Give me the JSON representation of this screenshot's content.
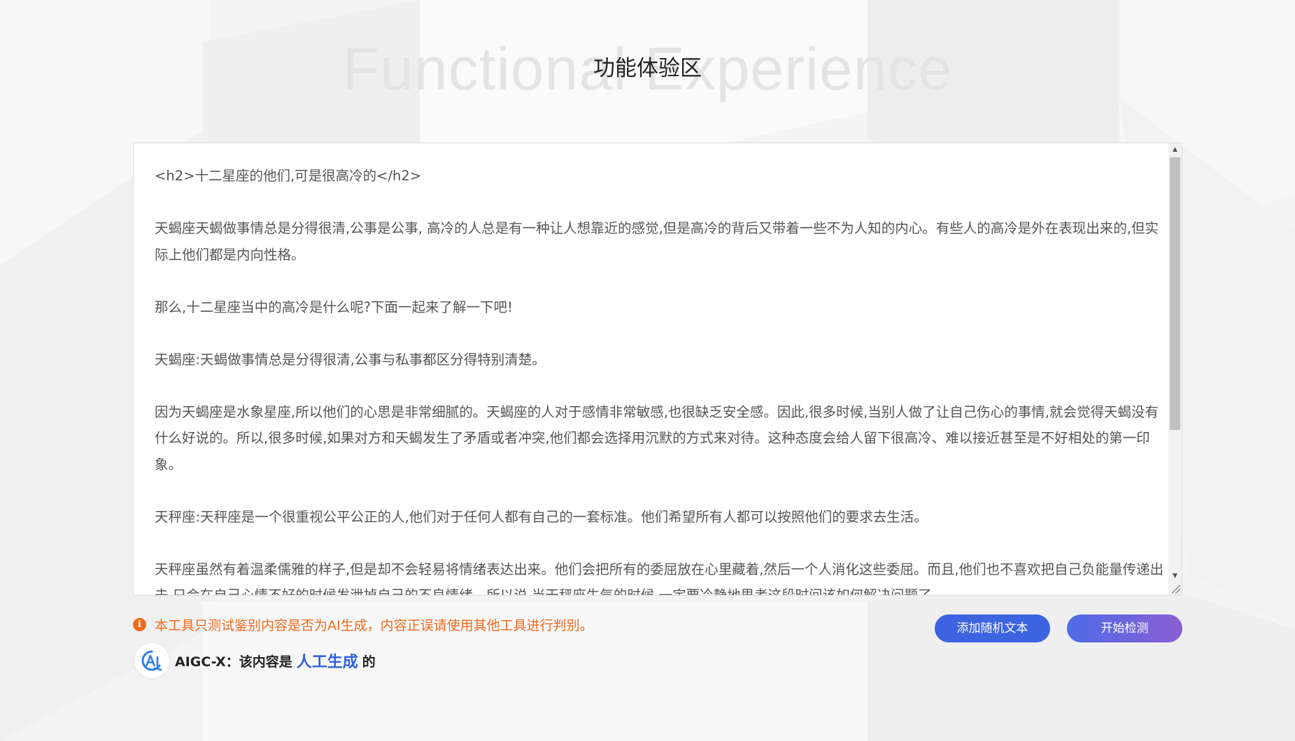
{
  "background": {
    "watermark": "Functional Experience"
  },
  "section": {
    "title": "功能体验区"
  },
  "editor": {
    "paragraphs": [
      "<h2>十二星座的他们,可是很高冷的</h2>",
      "天蝎座天蝎做事情总是分得很清,公事是公事, 高冷的人总是有一种让人想靠近的感觉,但是高冷的背后又带着一些不为人知的内心。有些人的高冷是外在表现出来的,但实际上他们都是内向性格。",
      "那么,十二星座当中的高冷是什么呢?下面一起来了解一下吧!",
      "天蝎座:天蝎做事情总是分得很清,公事与私事都区分得特别清楚。",
      "因为天蝎座是水象星座,所以他们的心思是非常细腻的。天蝎座的人对于感情非常敏感,也很缺乏安全感。因此,很多时候,当别人做了让自己伤心的事情,就会觉得天蝎没有什么好说的。所以,很多时候,如果对方和天蝎发生了矛盾或者冲突,他们都会选择用沉默的方式来对待。这种态度会给人留下很高冷、难以接近甚至是不好相处的第一印象。",
      "天秤座:天秤座是一个很重视公平公正的人,他们对于任何人都有自己的一套标准。他们希望所有人都可以按照他们的要求去生活。",
      "天秤座虽然有着温柔儒雅的样子,但是却不会轻易将情绪表达出来。他们会把所有的委屈放在心里藏着,然后一个人消化这些委屈。而且,他们也不喜欢把自己负能量传递出去,只会在自己心情不好的时候发泄掉自己的不良情绪。所以说,当天秤座生气的时候,一定要冷静地思考这段时间该如何解决问题了。"
    ]
  },
  "notice": {
    "icon": "info-icon",
    "text": "本工具只测试鉴别内容是否为AI生成，内容正误请使用其他工具进行判别。"
  },
  "buttons": {
    "random_label": "添加随机文本",
    "detect_label": "开始检测"
  },
  "result": {
    "prefix": "AIGC-X：该内容是",
    "verdict": "人工生成",
    "suffix": "的"
  },
  "colors": {
    "accent_blue": "#3d63e0",
    "warning_orange": "#f06a1c",
    "verdict_blue": "#2f5fe0"
  }
}
